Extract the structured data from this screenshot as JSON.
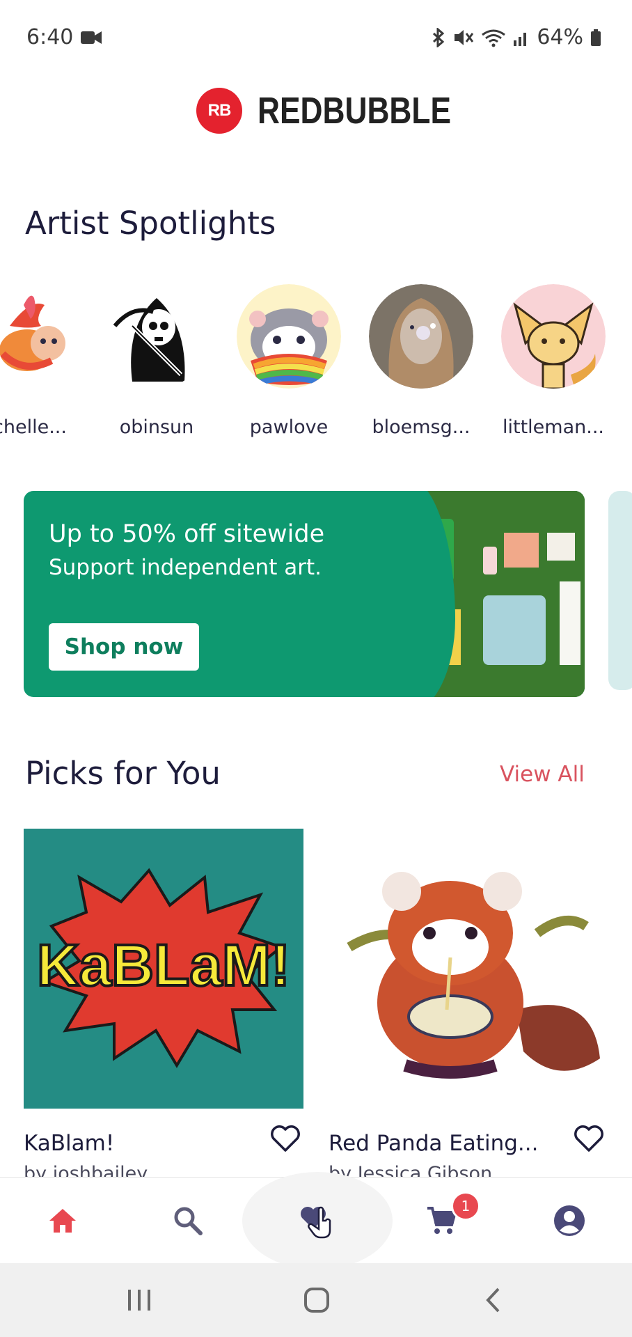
{
  "status_bar": {
    "time": "6:40",
    "battery": "64%",
    "icons": [
      "camera-icon",
      "bluetooth-icon",
      "mute-icon",
      "wifi-icon",
      "signal-icon",
      "battery-icon"
    ]
  },
  "brand": {
    "logo_mark": "RB",
    "name": "REDBUBBLE",
    "color": "#e4222e"
  },
  "spotlights": {
    "title": "Artist Spotlights",
    "artists": [
      {
        "name": "chelle..."
      },
      {
        "name": "obinsun"
      },
      {
        "name": "pawlove"
      },
      {
        "name": "bloemsg..."
      },
      {
        "name": "littleman..."
      }
    ]
  },
  "banner": {
    "headline": "Up to 50% off sitewide",
    "subtitle": "Support independent art.",
    "button_label": "Shop now",
    "color": "#0e9970"
  },
  "picks": {
    "title": "Picks for You",
    "view_all": "View All",
    "cards": [
      {
        "title": "KaBlam!",
        "by": "by joshbailey",
        "image_text": "KaBLaM!"
      },
      {
        "title": "Red Panda Eating...",
        "by": "by Jessica Gibson"
      }
    ]
  },
  "bottom_nav": {
    "items": [
      "home-icon",
      "search-icon",
      "favorites-icon",
      "cart-icon",
      "account-icon"
    ],
    "cart_badge": "1",
    "accent": "#e84850"
  }
}
